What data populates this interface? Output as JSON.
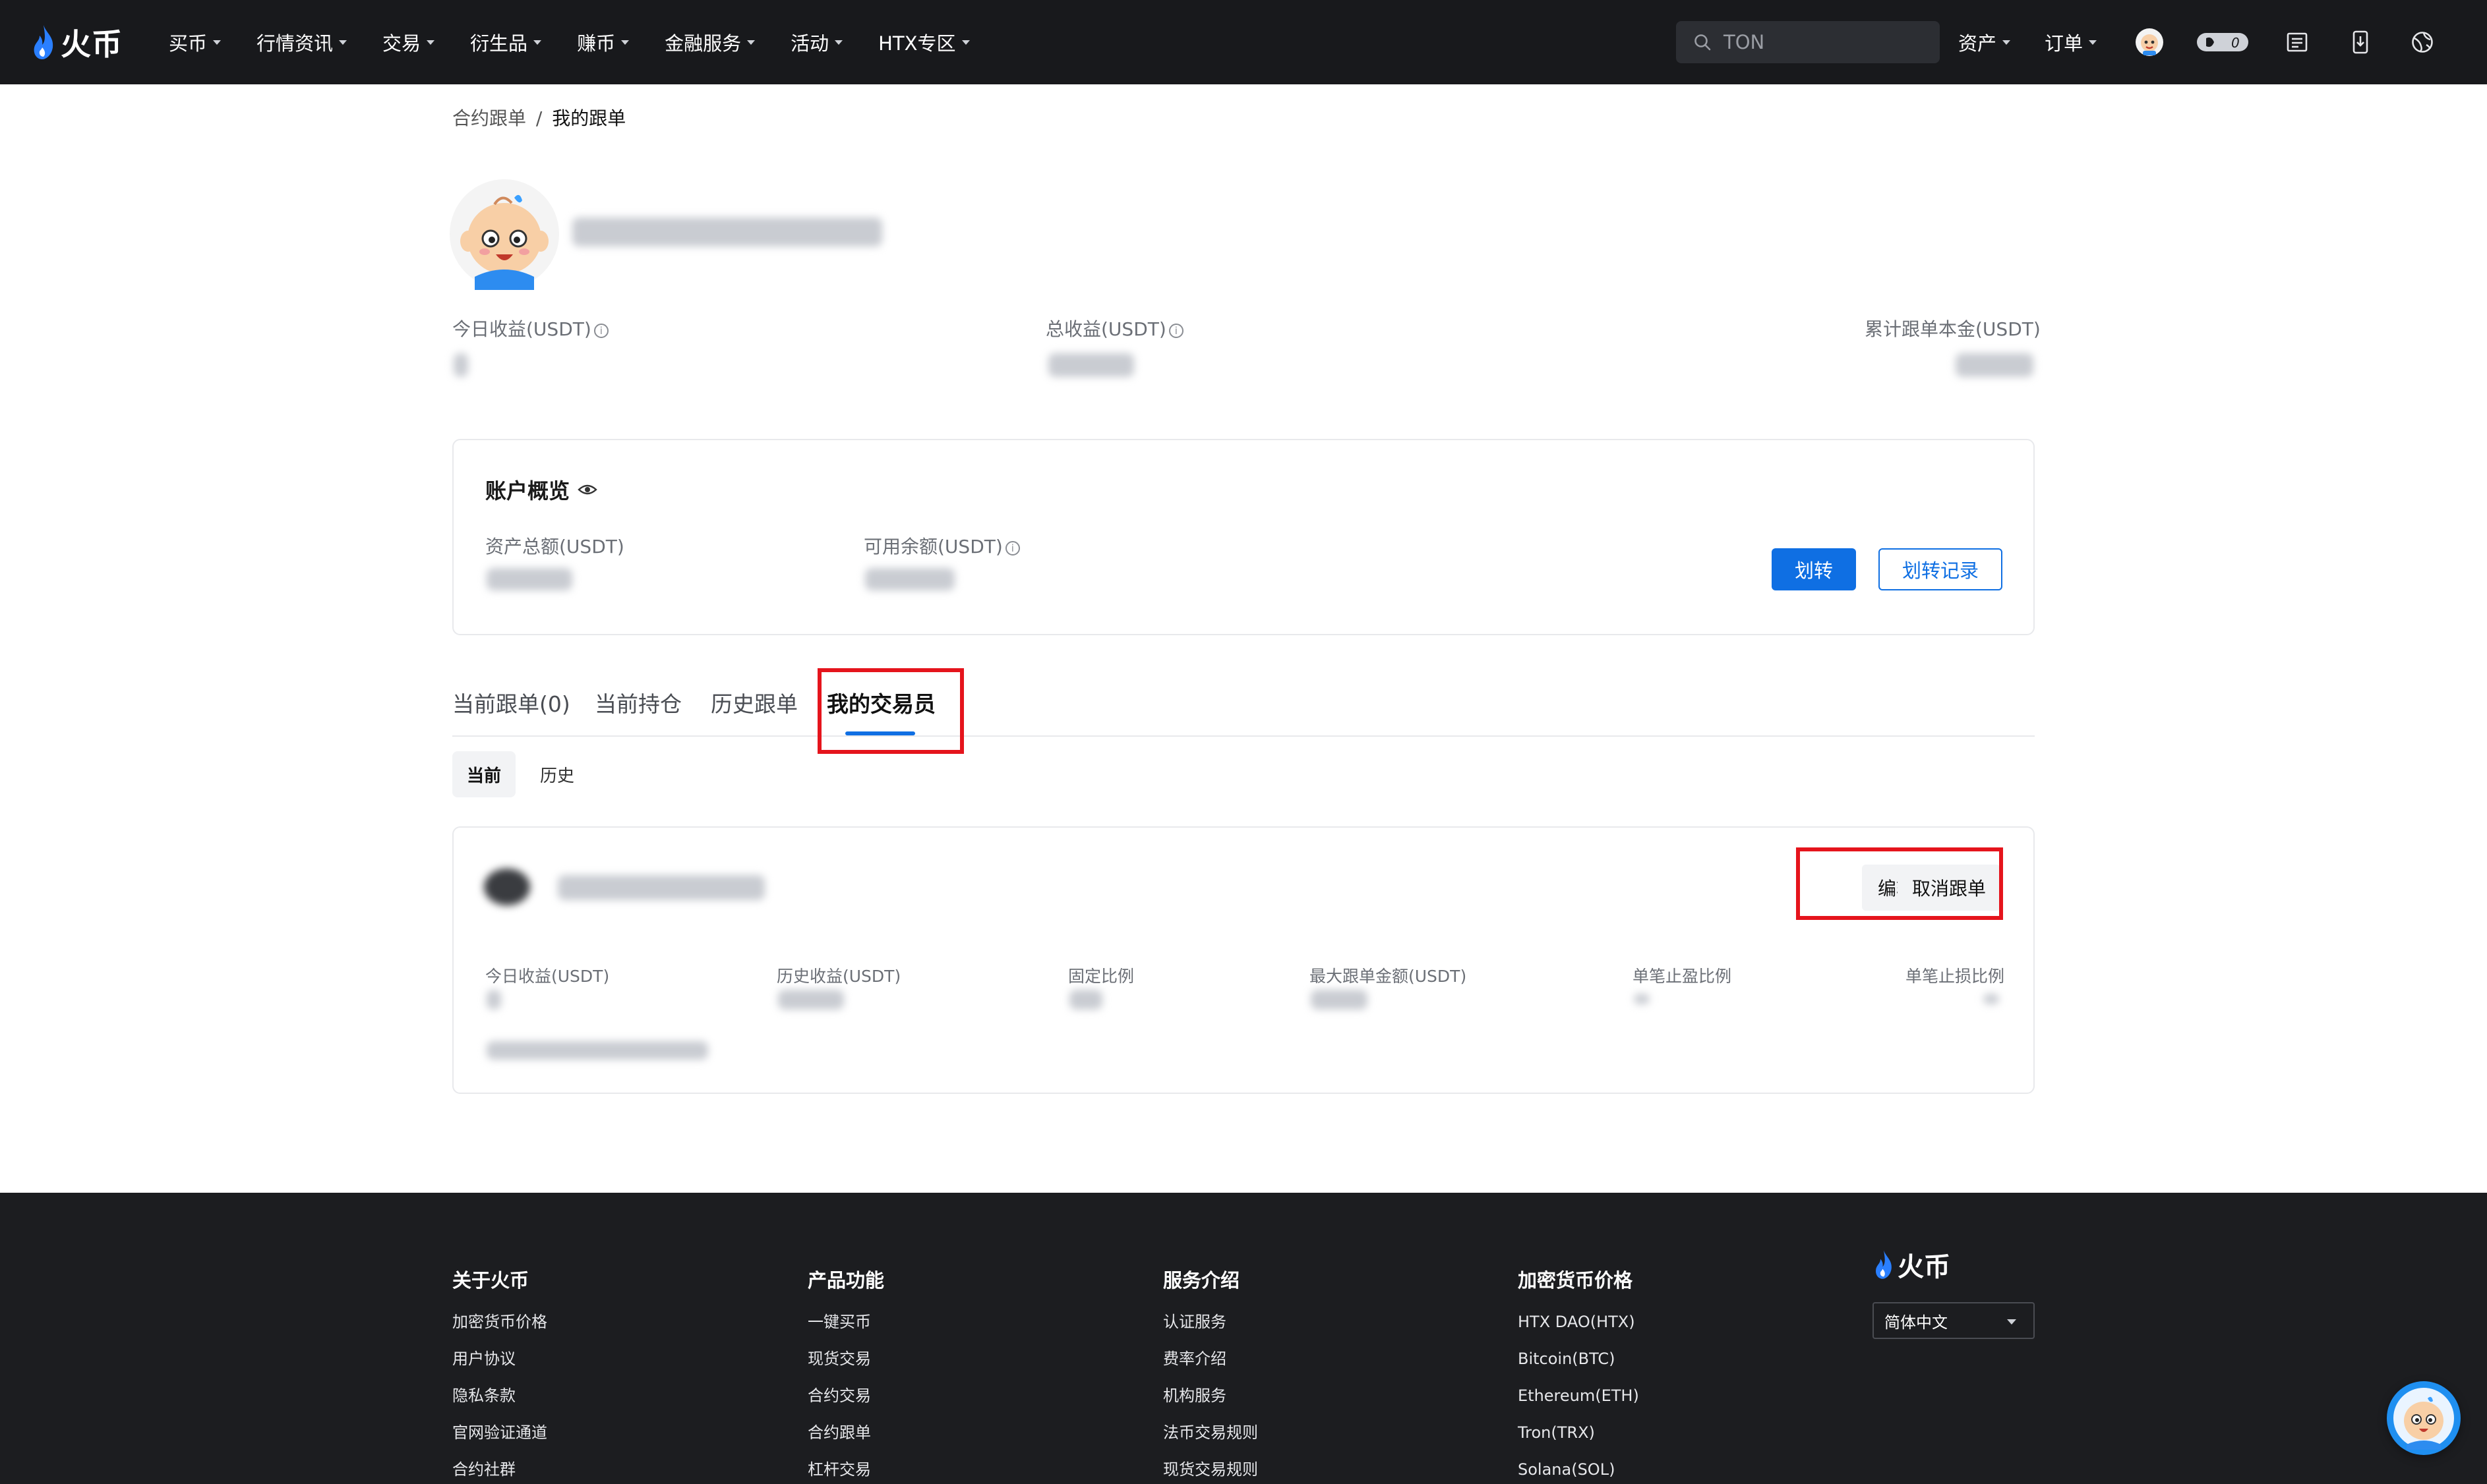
{
  "nav": {
    "logo_text": "火币",
    "items": [
      {
        "label": "买币"
      },
      {
        "label": "行情资讯"
      },
      {
        "label": "交易"
      },
      {
        "label": "衍生品"
      },
      {
        "label": "赚币"
      },
      {
        "label": "金融服务"
      },
      {
        "label": "活动"
      },
      {
        "label": "HTX专区"
      }
    ],
    "search_value": "TON",
    "assets_label": "资产",
    "orders_label": "订单",
    "badge_count": "0"
  },
  "breadcrumb": {
    "parent": "合约跟单",
    "separator": "/",
    "current": "我的跟单"
  },
  "stats": {
    "today_profit_label": "今日收益(USDT)",
    "total_profit_label": "总收益(USDT)",
    "cumulative_principal_label": "累计跟单本金(USDT)"
  },
  "account": {
    "title": "账户概览",
    "total_assets_label": "资产总额(USDT)",
    "available_label": "可用余额(USDT)",
    "transfer_button": "划转",
    "transfer_record_button": "划转记录"
  },
  "tabs": [
    {
      "label": "当前跟单(0)"
    },
    {
      "label": "当前持仓"
    },
    {
      "label": "历史跟单"
    },
    {
      "label": "我的交易员"
    }
  ],
  "sub_tabs": {
    "current": "当前",
    "history": "历史"
  },
  "trader_card": {
    "edit_button": "编辑",
    "cancel_button": "取消跟单",
    "columns": [
      {
        "label": "今日收益(USDT)"
      },
      {
        "label": "历史收益(USDT)"
      },
      {
        "label": "固定比例"
      },
      {
        "label": "最大跟单金额(USDT)"
      },
      {
        "label": "单笔止盈比例"
      },
      {
        "label": "单笔止损比例"
      }
    ]
  },
  "footer": {
    "columns": [
      {
        "title": "关于火币",
        "links": [
          "加密货币价格",
          "用户协议",
          "隐私条款",
          "官网验证通道",
          "合约社群"
        ]
      },
      {
        "title": "产品功能",
        "links": [
          "一键买币",
          "现货交易",
          "合约交易",
          "合约跟单",
          "杠杆交易"
        ]
      },
      {
        "title": "服务介绍",
        "links": [
          "认证服务",
          "费率介绍",
          "机构服务",
          "法币交易规则",
          "现货交易规则"
        ]
      },
      {
        "title": "加密货币价格",
        "links": [
          "HTX DAO(HTX)",
          "Bitcoin(BTC)",
          "Ethereum(ETH)",
          "Tron(TRX)",
          "Solana(SOL)"
        ]
      }
    ],
    "logo_text": "火币",
    "language": "简体中文"
  },
  "colors": {
    "brand_blue": "#0f6fe3",
    "highlight_red": "#e5141c",
    "topbar_bg": "#18191c",
    "footer_bg": "#1c1d20"
  }
}
